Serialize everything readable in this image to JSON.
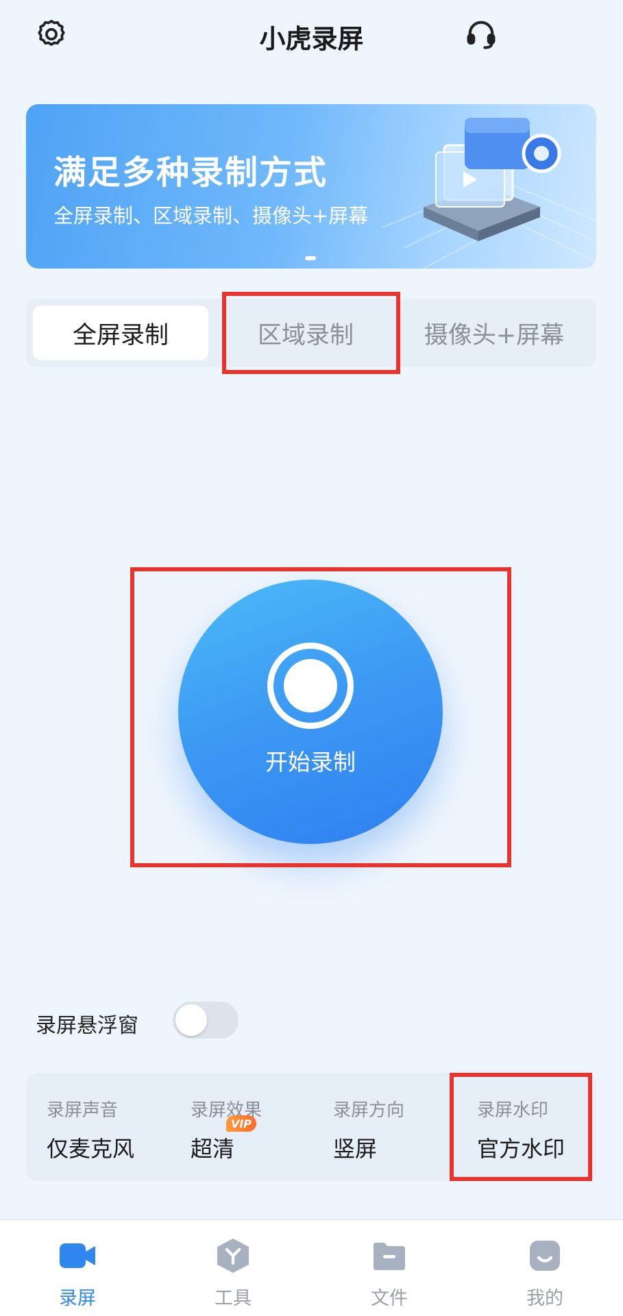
{
  "header": {
    "title": "小虎录屏",
    "settings_icon": "gear-icon",
    "support_icon": "headset-icon"
  },
  "banner": {
    "title": "满足多种录制方式",
    "subtitle": "全屏录制、区域录制、摄像头+屏幕"
  },
  "tabs": [
    {
      "label": "全屏录制",
      "active": true
    },
    {
      "label": "区域录制",
      "active": false
    },
    {
      "label": "摄像头+屏幕",
      "active": false
    }
  ],
  "record": {
    "label": "开始录制"
  },
  "floating_window": {
    "label": "录屏悬浮窗",
    "enabled": false
  },
  "settings": [
    {
      "label": "录屏声音",
      "value": "仅麦克风"
    },
    {
      "label": "录屏效果",
      "value": "超清",
      "badge": "VIP"
    },
    {
      "label": "录屏方向",
      "value": "竖屏"
    },
    {
      "label": "录屏水印",
      "value": "官方水印"
    }
  ],
  "nav": [
    {
      "label": "录屏",
      "icon": "video-camera-icon",
      "active": true
    },
    {
      "label": "工具",
      "icon": "toolbox-icon",
      "active": false
    },
    {
      "label": "文件",
      "icon": "folder-icon",
      "active": false
    },
    {
      "label": "我的",
      "icon": "profile-icon",
      "active": false
    }
  ],
  "colors": {
    "accent": "#2f86ef",
    "highlight_box": "#e8332f",
    "vip_badge": "#ff7a2f",
    "page_bg": "#eef5fd"
  }
}
